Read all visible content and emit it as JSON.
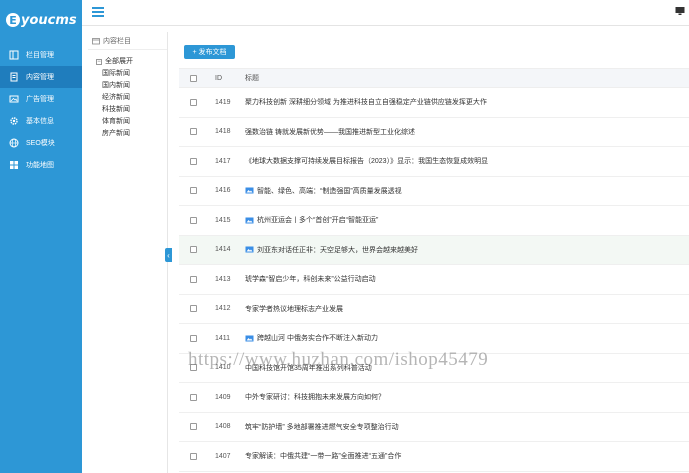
{
  "logo": {
    "mark": "E",
    "text": "youcms"
  },
  "nav": [
    {
      "label": "栏目管理",
      "icon": "columns-icon",
      "active": false
    },
    {
      "label": "内容管理",
      "icon": "document-icon",
      "active": true
    },
    {
      "label": "广告管理",
      "icon": "picture-icon",
      "active": false
    },
    {
      "label": "基本信息",
      "icon": "gear-icon",
      "active": false
    },
    {
      "label": "SEO模块",
      "icon": "globe-icon",
      "active": false
    },
    {
      "label": "功能地图",
      "icon": "map-icon",
      "active": false
    }
  ],
  "tree": {
    "header": "内容栏目",
    "root": "全部展开",
    "items": [
      "国际新闻",
      "国内新闻",
      "经济新闻",
      "科技新闻",
      "体育新闻",
      "房产新闻"
    ]
  },
  "toolbar": {
    "add_label": "+ 发布文档"
  },
  "table": {
    "headers": {
      "id": "ID",
      "title": "标题"
    },
    "rows": [
      {
        "id": "1419",
        "title": "聚力科技创新 深耕细分领域 为推进科技自立自强稳定产业链供应链发挥更大作",
        "img": false
      },
      {
        "id": "1418",
        "title": "强数治链 铸就发展新优势——我国推进新型工业化综述",
        "img": false
      },
      {
        "id": "1417",
        "title": "《地球大数据支撑可持续发展目标报告（2023）》显示：我国生态恢复成效明显",
        "img": false
      },
      {
        "id": "1416",
        "title": "智能、绿色、高端：“制造强国”高质量发展透视",
        "img": true
      },
      {
        "id": "1415",
        "title": "杭州亚运会丨多个“首创”开启“智能亚运”",
        "img": true
      },
      {
        "id": "1414",
        "title": "刘亚东对话任正非：天空足够大，世界会越来越美好",
        "img": true
      },
      {
        "id": "1413",
        "title": "琥学森“智启少年，科创未来”公益行动启动",
        "img": false
      },
      {
        "id": "1412",
        "title": "专家学者热议地理标志产业发展",
        "img": false
      },
      {
        "id": "1411",
        "title": "跨越山河 中俄务实合作不断注入新动力",
        "img": true
      },
      {
        "id": "1410",
        "title": "中国科技馆开馆35周年推出系列科普活动",
        "img": false
      },
      {
        "id": "1409",
        "title": "中外专家研讨：科技拥抱未来发展方向如何？",
        "img": false
      },
      {
        "id": "1408",
        "title": "筑牢“防护墙” 多地部署推进燃气安全专项整治行动",
        "img": false
      },
      {
        "id": "1407",
        "title": "专家解读：中俄共建“一带一路”全面推进“五通”合作",
        "img": false
      }
    ]
  },
  "watermark": "https://www.huzhan.com/ishop45479",
  "colors": {
    "accent": "#2d97d6",
    "nav_active": "#1f7dbd",
    "row_highlight": "#f3f8f4"
  }
}
